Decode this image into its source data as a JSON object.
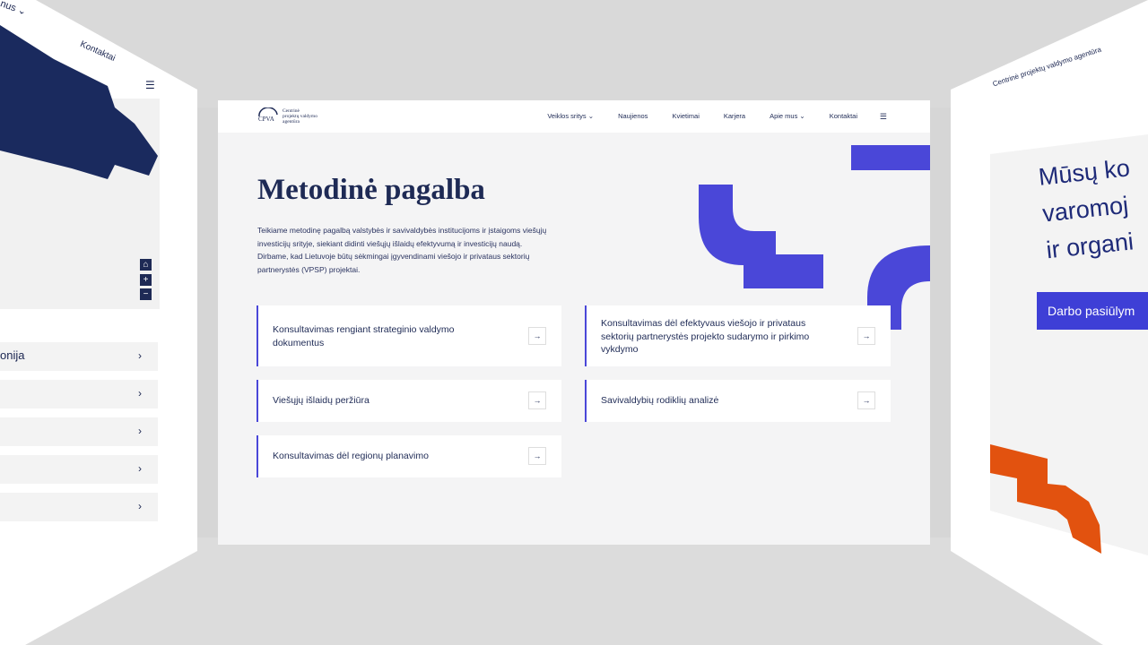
{
  "main": {
    "logo": {
      "abbr": "CPVA",
      "lines": [
        "Centrinė",
        "projektų valdymo",
        "agentūra"
      ]
    },
    "nav": {
      "items": [
        {
          "label": "Veiklos sritys",
          "has_dropdown": true
        },
        {
          "label": "Naujienos",
          "has_dropdown": false
        },
        {
          "label": "Kvietimai",
          "has_dropdown": false
        },
        {
          "label": "Karjera",
          "has_dropdown": false
        },
        {
          "label": "Apie mus",
          "has_dropdown": true
        },
        {
          "label": "Kontaktai",
          "has_dropdown": false
        }
      ],
      "menu_icon": "hamburger-icon",
      "dropdown_icon": "chevron-down-icon"
    },
    "title": "Metodinė pagalba",
    "description": "Teikiame metodinę pagalbą valstybės ir savivaldybės institucijoms ir įstaigoms viešųjų investicijų srityje, siekiant didinti viešųjų išlaidų efektyvumą ir investicijų naudą. Dirbame, kad Lietuvoje būtų sėkmingai įgyvendinami viešojo ir privataus sektorių partnerystės (VPSP) projektai.",
    "cards": [
      {
        "label": "Konsultavimas rengiant strateginio valdymo dokumentus"
      },
      {
        "label": "Konsultavimas dėl efektyvaus viešojo ir privataus sektorių partnerystės projekto sudarymo ir pirkimo vykdymo"
      },
      {
        "label": "Viešųjų išlaidų peržiūra"
      },
      {
        "label": "Savivaldybių rodiklių analizė"
      },
      {
        "label": "Konsultavimas dėl regionų planavimo"
      }
    ],
    "card_icon": "arrow-right-icon",
    "colors": {
      "accent": "#4a47d8",
      "navy": "#1e2a55",
      "background": "#f4f4f5"
    }
  },
  "left_panel": {
    "lang_label": "nus",
    "contact_label": "Kontaktai",
    "map_controls": [
      "⌂",
      "+",
      "−"
    ],
    "rows": [
      {
        "label": "onija"
      },
      {
        "label": ""
      },
      {
        "label": ""
      },
      {
        "label": ""
      },
      {
        "label": ""
      }
    ]
  },
  "right_panel": {
    "logo_text": "Centrinė projektų valdymo agentūra",
    "title_lines": [
      "Mūsų ko",
      "varomoj",
      "ir organi"
    ],
    "button_label": "Darbo pasiūlym",
    "accent_orange": "#e2520f"
  }
}
